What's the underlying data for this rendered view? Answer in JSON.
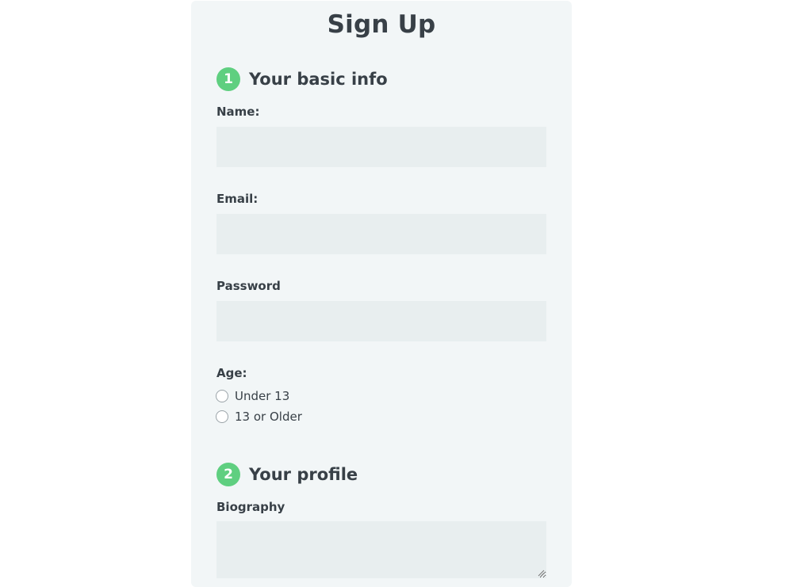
{
  "form": {
    "title": "Sign Up",
    "sections": [
      {
        "number": "1",
        "title": "Your basic info"
      },
      {
        "number": "2",
        "title": "Your profile"
      }
    ],
    "fields": {
      "name": {
        "label": "Name:",
        "value": "",
        "placeholder": ""
      },
      "email": {
        "label": "Email:",
        "value": "",
        "placeholder": ""
      },
      "password": {
        "label": "Password",
        "value": "",
        "placeholder": ""
      },
      "age": {
        "label": "Age:",
        "options": [
          "Under 13",
          "13 or Older"
        ],
        "selected": null
      },
      "biography": {
        "label": "Biography",
        "value": "",
        "placeholder": ""
      }
    }
  },
  "colors": {
    "card_background": "#f2f6f7",
    "input_background": "#e8eeef",
    "step_badge": "#5fcf80",
    "text": "#384047"
  }
}
